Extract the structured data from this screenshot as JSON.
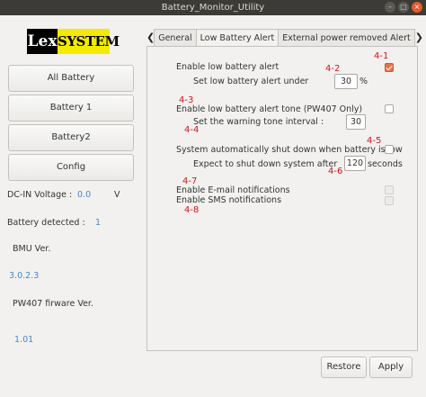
{
  "window": {
    "title": "Battery_Monitor_Utility",
    "min_glyph": "–",
    "max_glyph": "□",
    "close_glyph": "×"
  },
  "logo": {
    "lex": "Lex",
    "system": "SYSTEM"
  },
  "sidebar": {
    "buttons": [
      "All Battery",
      "Battery 1",
      "Battery2",
      "Config"
    ],
    "dcin_label": "DC-IN Voltage :",
    "dcin_value": "0.0",
    "dcin_unit": "V",
    "detected_label": "Battery detected :",
    "detected_value": "1",
    "bmu_label": "BMU Ver.",
    "bmu_value": "3.0.2.3",
    "pw407_label": "PW407 firware Ver.",
    "pw407_value": "1.01"
  },
  "tabs": {
    "prev_arrow": "❮",
    "next_arrow": "❯",
    "items": [
      "General",
      "Low Battery Alert",
      "External power removed Alert"
    ],
    "active": "Low Battery Alert"
  },
  "settings": {
    "low_alert_label": "Enable low battery alert",
    "low_alert_under_label": "Set low battery alert under",
    "low_alert_under_value": "30",
    "low_alert_under_unit": "%",
    "tone_label": "Enable low battery alert tone (PW407 Only)",
    "tone_interval_label": "Set the warning tone interval :",
    "tone_interval_value": "30",
    "shutdown_label": "System automatically shut down when battery is low",
    "shutdown_after_label": "Expect to shut down system after",
    "shutdown_after_value": "120",
    "shutdown_after_unit": "seconds",
    "email_label": "Enable E-mail notifications",
    "sms_label": "Enable SMS notifications"
  },
  "annotations": [
    "4-1",
    "4-2",
    "4-3",
    "4-4",
    "4-5",
    "4-6",
    "4-7",
    "4-8"
  ],
  "footer": {
    "restore_label": "Restore",
    "apply_label": "Apply"
  },
  "colors": {
    "accent": "#e5734a",
    "annotation": "#d3141b",
    "info_value": "#4a86c8"
  }
}
